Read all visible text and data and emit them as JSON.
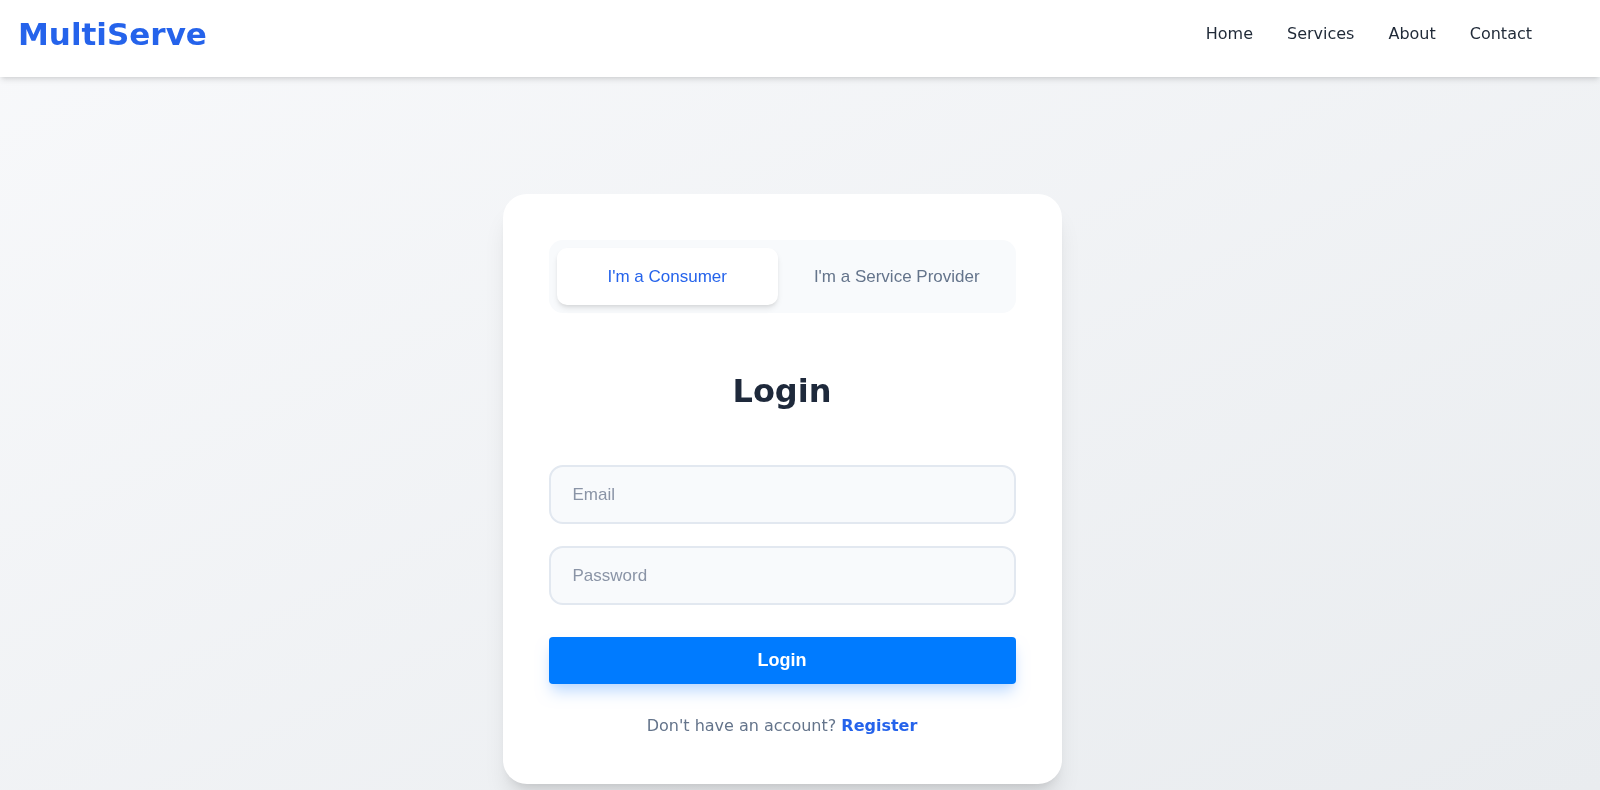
{
  "header": {
    "logo": "MultiServe",
    "nav": [
      {
        "label": "Home"
      },
      {
        "label": "Services"
      },
      {
        "label": "About"
      },
      {
        "label": "Contact"
      }
    ]
  },
  "tabs": [
    {
      "label": "I'm a Consumer",
      "selected": true
    },
    {
      "label": "I'm a Service Provider",
      "selected": false
    }
  ],
  "title": "Login",
  "fields": [
    {
      "placeholder": "Email"
    },
    {
      "placeholder": "Password"
    }
  ],
  "button": "Login",
  "footer": {
    "text": "Don't have an account?",
    "link": "Register"
  }
}
